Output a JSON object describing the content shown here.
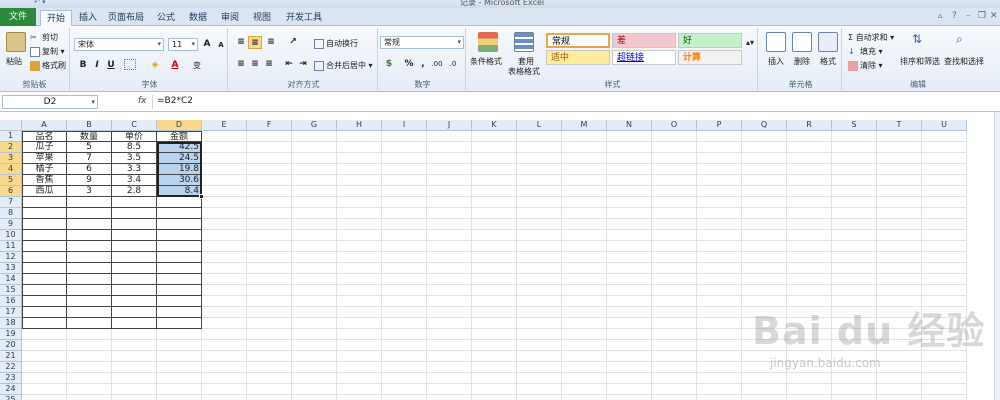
{
  "window": {
    "title": "记录 - Microsoft Excel",
    "qat": "↶ ▾"
  },
  "tabs": [
    "文件",
    "开始",
    "插入",
    "页面布局",
    "公式",
    "数据",
    "审阅",
    "视图",
    "开发工具"
  ],
  "ribbon": {
    "clipboard": {
      "label": "剪贴板",
      "paste": "粘贴",
      "cut": "剪切",
      "copy": "复制 ▾",
      "format_painter": "格式刷"
    },
    "font": {
      "label": "字体",
      "name": "宋体",
      "size": "11",
      "grow": "A",
      "shrink": "A",
      "bold": "B",
      "italic": "I",
      "underline": "U",
      "fontcolor": "A",
      "wen": "变"
    },
    "alignment": {
      "label": "对齐方式",
      "wrap": "自动换行",
      "merge": "合并后居中 ▾"
    },
    "number": {
      "label": "数字",
      "format": "常规",
      "percent": "%",
      "comma": ",",
      "dec_inc": ".00",
      "dec_dec": ".0"
    },
    "styles": {
      "label": "样式",
      "conditional": "条件格式",
      "as_table": "套用",
      "as_table2": "表格格式",
      "cells": [
        {
          "text": "常规",
          "bg": "#ffffff",
          "color": "#000000"
        },
        {
          "text": "差",
          "bg": "#f4c7ce",
          "color": "#9c0006"
        },
        {
          "text": "好",
          "bg": "#c6efce",
          "color": "#006100"
        },
        {
          "text": "适中",
          "bg": "#ffeb9c",
          "color": "#9c5700"
        },
        {
          "text": "超链接",
          "bg": "#ffffff",
          "color": "#0000ff"
        },
        {
          "text": "计算",
          "bg": "#f2f2f2",
          "color": "#fa7d00"
        }
      ]
    },
    "cells": {
      "label": "单元格",
      "insert": "插入",
      "delete": "删除",
      "format": "格式"
    },
    "editing": {
      "label": "编辑",
      "autosum": "Σ 自动求和 ▾",
      "fill": "填充 ▾",
      "clear": "清除 ▾",
      "sort": "排序和筛选",
      "find": "查找和选择"
    }
  },
  "formula_bar": {
    "name_box": "D2",
    "fx": "fx",
    "formula": "=B2*C2"
  },
  "sheet": {
    "columns": [
      "A",
      "B",
      "C",
      "D",
      "E",
      "F",
      "G",
      "H",
      "I",
      "J",
      "K",
      "L",
      "M",
      "N",
      "O",
      "P",
      "Q",
      "R",
      "S",
      "T",
      "U"
    ],
    "selected_column": "D",
    "selected_rows": [
      2,
      3,
      4,
      5,
      6
    ],
    "row_count": 25,
    "headers": [
      "品名",
      "数量",
      "单价",
      "金额"
    ],
    "rows": [
      [
        "瓜子",
        "5",
        "8.5",
        "42.5"
      ],
      [
        "苹果",
        "7",
        "3.5",
        "24.5"
      ],
      [
        "橘子",
        "6",
        "3.3",
        "19.8"
      ],
      [
        "香蕉",
        "9",
        "3.4",
        "30.6"
      ],
      [
        "西瓜",
        "3",
        "2.8",
        "8.4"
      ]
    ]
  },
  "watermark": {
    "main": "Bai du 经验",
    "sub": "jingyan.baidu.com"
  }
}
